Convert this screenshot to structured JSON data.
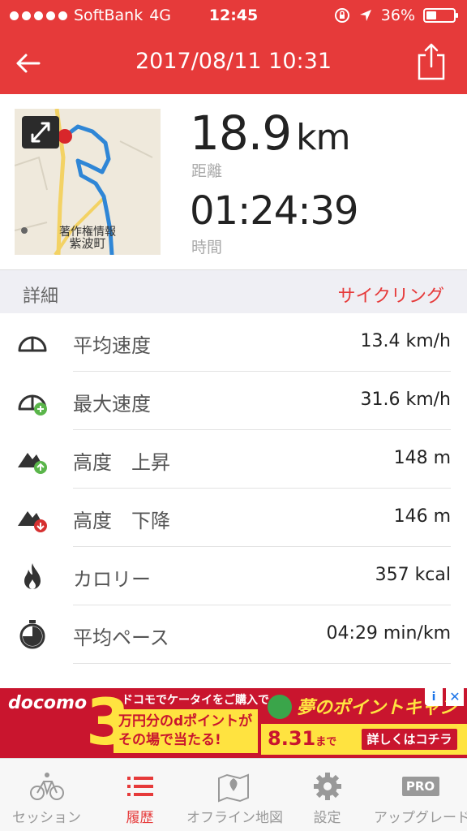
{
  "status_bar": {
    "carrier": "SoftBank",
    "network": "4G",
    "time": "12:45",
    "battery": "36%",
    "battery_level": 0.36
  },
  "nav": {
    "title": "2017/08/11 10:31",
    "back_icon": "back-arrow-icon",
    "share_icon": "share-icon"
  },
  "summary": {
    "distance_value": "18.9",
    "distance_unit": "km",
    "distance_label": "距離",
    "time_value": "01:24:39",
    "time_label": "時間",
    "map_label_top": "著作権情報",
    "map_label_bottom": "紫波町"
  },
  "detail_header": {
    "title": "詳細",
    "activity": "サイクリング"
  },
  "rows": [
    {
      "icon": "speedometer-icon",
      "label": "平均速度",
      "value": "13.4 km/h"
    },
    {
      "icon": "speedometer-plus-icon",
      "label": "最大速度",
      "value": "31.6 km/h"
    },
    {
      "icon": "mountain-up-icon",
      "label": "高度　上昇",
      "value": "148 m"
    },
    {
      "icon": "mountain-down-icon",
      "label": "高度　下降",
      "value": "146 m"
    },
    {
      "icon": "flame-icon",
      "label": "カロリー",
      "value": "357 kcal"
    },
    {
      "icon": "stopwatch-icon",
      "label": "平均ペース",
      "value": "04:29 min/km"
    }
  ],
  "ad": {
    "brand": "docomo",
    "number": "3",
    "line1": "ドコモでケータイをご購入で",
    "line2": "万円分のdポイントが",
    "line3": "その場で当たる!",
    "promo": "夢のポイントキャンペーン",
    "date": "8.31",
    "date_suffix": "まで",
    "cta": "詳しくはコチラ"
  },
  "tabs": [
    {
      "icon": "bicycle-icon",
      "label": "セッション",
      "active": false
    },
    {
      "icon": "list-icon",
      "label": "履歴",
      "active": true
    },
    {
      "icon": "map-pin-icon",
      "label": "オフライン地図",
      "active": false
    },
    {
      "icon": "gear-icon",
      "label": "設定",
      "active": false
    },
    {
      "icon": "pro-badge-icon",
      "label": "アップグレード",
      "active": false,
      "badge": "PRO"
    }
  ],
  "colors": {
    "accent": "#e63a3a",
    "route": "#2f86d6",
    "positive": "#5ab54a",
    "negative": "#d63030"
  }
}
